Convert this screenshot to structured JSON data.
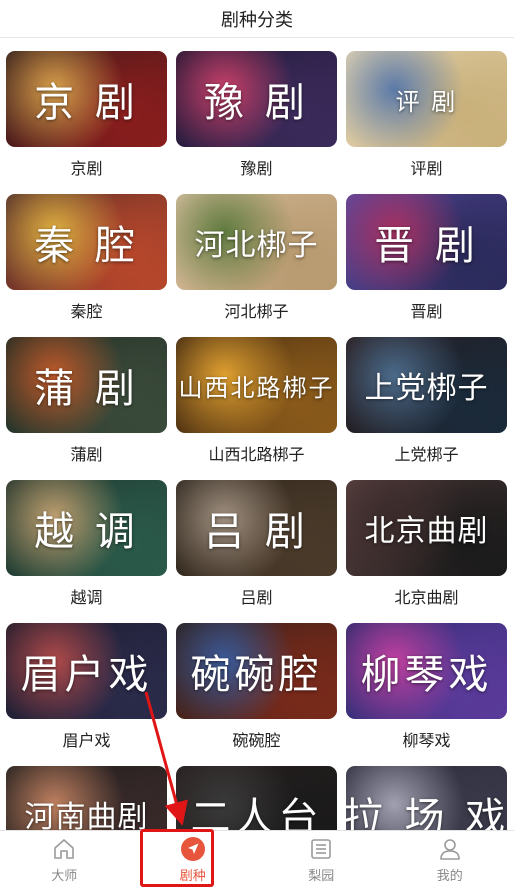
{
  "header": {
    "title": "剧种分类"
  },
  "tiles": [
    {
      "overlay": "京 剧",
      "label": "京剧",
      "size": "large",
      "c1": "#8a1d1d",
      "c2": "#d9a04a",
      "c3": "#2b1a1a"
    },
    {
      "overlay": "豫 剧",
      "label": "豫剧",
      "size": "large",
      "c1": "#3a2a5a",
      "c2": "#c9406a",
      "c3": "#1e1630"
    },
    {
      "overlay": "评 剧",
      "label": "评剧",
      "size": "small",
      "c1": "#c9b07a",
      "c2": "#5b7aa8",
      "c3": "#e7d7b5"
    },
    {
      "overlay": "秦 腔",
      "label": "秦腔",
      "size": "large",
      "c1": "#b8472b",
      "c2": "#e0b040",
      "c3": "#4a2a2a"
    },
    {
      "overlay": "河北梆子",
      "label": "河北梆子",
      "size": "medium",
      "c1": "#b89a70",
      "c2": "#5e7a3e",
      "c3": "#d8c0a0"
    },
    {
      "overlay": "晋 剧",
      "label": "晋剧",
      "size": "large",
      "c1": "#2a2a5a",
      "c2": "#a83060",
      "c3": "#5a4aa0"
    },
    {
      "overlay": "蒲 剧",
      "label": "蒲剧",
      "size": "large",
      "c1": "#3a4a3a",
      "c2": "#c05a2a",
      "c3": "#1e2a22"
    },
    {
      "overlay": "山西北路梆子",
      "label": "山西北路梆子",
      "size": "small",
      "c1": "#8a5a1a",
      "c2": "#e0a030",
      "c3": "#3a2410"
    },
    {
      "overlay": "上党梆子",
      "label": "上党梆子",
      "size": "medium",
      "c1": "#1a2a3a",
      "c2": "#4a6a8a",
      "c3": "#2a1a1a"
    },
    {
      "overlay": "越 调",
      "label": "越调",
      "size": "large",
      "c1": "#2a5a4a",
      "c2": "#c0a070",
      "c3": "#1e3028"
    },
    {
      "overlay": "吕 剧",
      "label": "吕剧",
      "size": "large",
      "c1": "#4a3a2a",
      "c2": "#a09080",
      "c3": "#2a221a"
    },
    {
      "overlay": "北京曲剧",
      "label": "北京曲剧",
      "size": "medium",
      "c1": "#1a1a1a",
      "c2": "#3a2a2a",
      "c3": "#5a4040"
    },
    {
      "overlay": "眉户戏",
      "label": "眉户戏",
      "size": "large",
      "c1": "#2a2a4a",
      "c2": "#b04a4a",
      "c3": "#1a1a2a"
    },
    {
      "overlay": "碗碗腔",
      "label": "碗碗腔",
      "size": "large",
      "c1": "#7a2a1a",
      "c2": "#3a5a9a",
      "c3": "#2a1e1a"
    },
    {
      "overlay": "柳琴戏",
      "label": "柳琴戏",
      "size": "large",
      "c1": "#5a3a9a",
      "c2": "#c040a0",
      "c3": "#2a2a6a"
    },
    {
      "overlay": "河南曲剧",
      "label": "",
      "size": "medium",
      "c1": "#3a2a2a",
      "c2": "#c08060",
      "c3": "#1a1a1a"
    },
    {
      "overlay": "二人台",
      "label": "",
      "size": "large",
      "c1": "#1a1a1a",
      "c2": "#3a3a3a",
      "c3": "#2a2020"
    },
    {
      "overlay": "拉 场 戏",
      "label": "",
      "size": "large",
      "c1": "#3a3a4a",
      "c2": "#a0a0b0",
      "c3": "#2a2a3a"
    }
  ],
  "tabbar": {
    "tabs": [
      {
        "label": "大师",
        "icon": "home-icon",
        "active": false
      },
      {
        "label": "剧种",
        "icon": "navigation-arrow-icon",
        "active": true
      },
      {
        "label": "梨园",
        "icon": "list-icon",
        "active": false
      },
      {
        "label": "我的",
        "icon": "person-icon",
        "active": false
      }
    ]
  },
  "colors": {
    "accent": "#e8553d",
    "highlight": "#e01616",
    "inactive": "#888888"
  }
}
